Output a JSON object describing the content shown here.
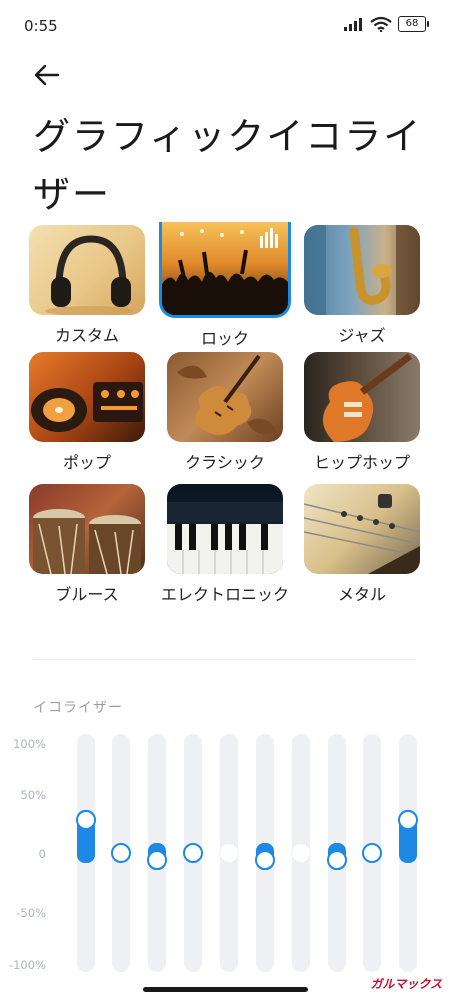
{
  "status_bar": {
    "time": "0:55",
    "battery": "68"
  },
  "header": {
    "title": "グラフィックイコライザー"
  },
  "presets": [
    {
      "label": "カスタム",
      "image": "headphones",
      "selected": false
    },
    {
      "label": "ロック",
      "image": "concert-crowd",
      "selected": true
    },
    {
      "label": "ジャズ",
      "image": "saxophone",
      "selected": false
    },
    {
      "label": "ポップ",
      "image": "dj-turntable",
      "selected": false
    },
    {
      "label": "クラシック",
      "image": "violin",
      "selected": false
    },
    {
      "label": "ヒップホップ",
      "image": "electric-guitar",
      "selected": false
    },
    {
      "label": "ブルース",
      "image": "drums",
      "selected": false
    },
    {
      "label": "エレクトロニック",
      "image": "keyboard",
      "selected": false
    },
    {
      "label": "メタル",
      "image": "guitar-strings",
      "selected": false
    }
  ],
  "equalizer": {
    "section_label": "イコライザー",
    "axis_labels": [
      "100%",
      "50%",
      "0",
      "-50%",
      "-100%"
    ],
    "bands_percent": [
      30,
      0,
      -6,
      0,
      0,
      -6,
      0,
      -6,
      0,
      30
    ]
  },
  "watermark": "ガルマックス",
  "colors": {
    "accent": "#1e88e5",
    "track": "#eef0f4"
  }
}
